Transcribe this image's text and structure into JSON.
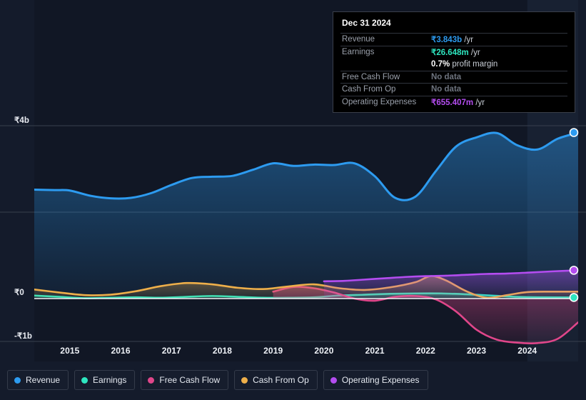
{
  "tooltip": {
    "title": "Dec 31 2024",
    "rows": [
      {
        "key": "Revenue",
        "value": "₹3.843b",
        "unit": "/yr",
        "color": "#2d9bf0",
        "no_data": false
      },
      {
        "key": "Earnings",
        "value": "₹26.648m",
        "unit": "/yr",
        "color": "#2ee6c0",
        "no_data": false
      },
      {
        "key": "",
        "value": "0.7%",
        "unit": "profit margin",
        "color": "#ffffff",
        "no_data": false
      },
      {
        "key": "Free Cash Flow",
        "value": "No data",
        "unit": "",
        "color": "#6e747f",
        "no_data": true
      },
      {
        "key": "Cash From Op",
        "value": "No data",
        "unit": "",
        "color": "#6e747f",
        "no_data": true
      },
      {
        "key": "Operating Expenses",
        "value": "₹655.407m",
        "unit": "/yr",
        "color": "#b44df0",
        "no_data": false
      }
    ]
  },
  "legend": {
    "items": [
      {
        "label": "Revenue",
        "color": "#2d9bf0"
      },
      {
        "label": "Earnings",
        "color": "#2ee6c0"
      },
      {
        "label": "Free Cash Flow",
        "color": "#e0468a"
      },
      {
        "label": "Cash From Op",
        "color": "#eeaf4a"
      },
      {
        "label": "Operating Expenses",
        "color": "#b44df0"
      }
    ]
  },
  "chart_data": {
    "type": "area",
    "title": "",
    "xlabel": "",
    "ylabel": "",
    "currency": "₹",
    "grid": true,
    "legend_position": "bottom",
    "xlim": [
      2014.3,
      2025.0
    ],
    "ylim": [
      -1.45,
      4.5
    ],
    "y_ticks": [
      {
        "value": 4,
        "label": "₹4b"
      },
      {
        "value": 2,
        "label": ""
      },
      {
        "value": 0,
        "label": "₹0"
      },
      {
        "value": -1,
        "label": "-₹1b"
      }
    ],
    "x_ticks": [
      2015,
      2016,
      2017,
      2018,
      2019,
      2020,
      2021,
      2022,
      2023,
      2024
    ],
    "forecast_band_start": 2024.0,
    "series": [
      {
        "name": "Revenue",
        "color": "#2d9bf0",
        "fill": true,
        "x": [
          2014.3,
          2014.7,
          2015.0,
          2015.4,
          2015.8,
          2016.2,
          2016.6,
          2017.0,
          2017.4,
          2017.8,
          2018.2,
          2018.6,
          2019.0,
          2019.4,
          2019.8,
          2020.2,
          2020.6,
          2021.0,
          2021.4,
          2021.8,
          2022.2,
          2022.6,
          2023.0,
          2023.4,
          2023.8,
          2024.2,
          2024.6,
          2025.0
        ],
        "values": [
          2.52,
          2.51,
          2.5,
          2.38,
          2.32,
          2.33,
          2.44,
          2.63,
          2.79,
          2.82,
          2.84,
          2.98,
          3.13,
          3.07,
          3.1,
          3.09,
          3.13,
          2.83,
          2.33,
          2.36,
          2.95,
          3.52,
          3.73,
          3.83,
          3.55,
          3.45,
          3.7,
          3.84
        ]
      },
      {
        "name": "Earnings",
        "color": "#2ee6c0",
        "fill": true,
        "x": [
          2014.3,
          2014.8,
          2015.3,
          2015.8,
          2016.3,
          2016.8,
          2017.3,
          2017.8,
          2018.3,
          2018.8,
          2019.3,
          2019.8,
          2020.3,
          2020.8,
          2021.3,
          2021.8,
          2022.3,
          2022.8,
          2023.3,
          2023.8,
          2024.3,
          2025.0
        ],
        "values": [
          0.07,
          0.04,
          0.01,
          0.02,
          0.03,
          0.02,
          0.04,
          0.06,
          0.04,
          0.02,
          0.02,
          0.03,
          0.07,
          0.09,
          0.11,
          0.12,
          0.12,
          0.1,
          0.07,
          0.04,
          0.03,
          0.027
        ]
      },
      {
        "name": "Free Cash Flow",
        "color": "#e0468a",
        "fill": true,
        "start_x": 2019.0,
        "x": [
          2019.0,
          2019.4,
          2019.8,
          2020.2,
          2020.6,
          2021.0,
          2021.4,
          2021.8,
          2022.2,
          2022.6,
          2023.0,
          2023.4,
          2023.8,
          2024.2,
          2024.6,
          2025.0
        ],
        "values": [
          0.16,
          0.27,
          0.24,
          0.14,
          0.0,
          -0.05,
          0.04,
          0.06,
          -0.02,
          -0.3,
          -0.72,
          -0.95,
          -1.02,
          -1.03,
          -0.93,
          -0.55
        ]
      },
      {
        "name": "Cash From Op",
        "color": "#eeaf4a",
        "fill": true,
        "x": [
          2014.3,
          2014.8,
          2015.3,
          2015.8,
          2016.3,
          2016.8,
          2017.3,
          2017.8,
          2018.3,
          2018.8,
          2019.3,
          2019.8,
          2020.3,
          2020.8,
          2021.3,
          2021.8,
          2022.1,
          2022.4,
          2022.8,
          2023.2,
          2023.6,
          2024.0,
          2024.5,
          2025.0
        ],
        "values": [
          0.21,
          0.14,
          0.08,
          0.09,
          0.17,
          0.29,
          0.36,
          0.33,
          0.25,
          0.22,
          0.28,
          0.33,
          0.24,
          0.2,
          0.26,
          0.38,
          0.52,
          0.42,
          0.17,
          0.02,
          0.08,
          0.15,
          0.16,
          0.16
        ]
      },
      {
        "name": "Operating Expenses",
        "color": "#b44df0",
        "fill": true,
        "start_x": 2020.0,
        "x": [
          2020.0,
          2020.4,
          2020.8,
          2021.2,
          2021.6,
          2022.0,
          2022.4,
          2022.8,
          2023.2,
          2023.6,
          2024.0,
          2024.5,
          2025.0
        ],
        "values": [
          0.4,
          0.41,
          0.44,
          0.47,
          0.5,
          0.52,
          0.53,
          0.55,
          0.57,
          0.58,
          0.6,
          0.63,
          0.655
        ]
      }
    ],
    "end_markers": [
      {
        "name": "Revenue",
        "color": "#2d9bf0",
        "value": 3.843
      },
      {
        "name": "Operating Expenses",
        "color": "#b44df0",
        "value": 0.655
      },
      {
        "name": "Earnings",
        "color": "#2ee6c0",
        "value": 0.0266
      }
    ]
  }
}
